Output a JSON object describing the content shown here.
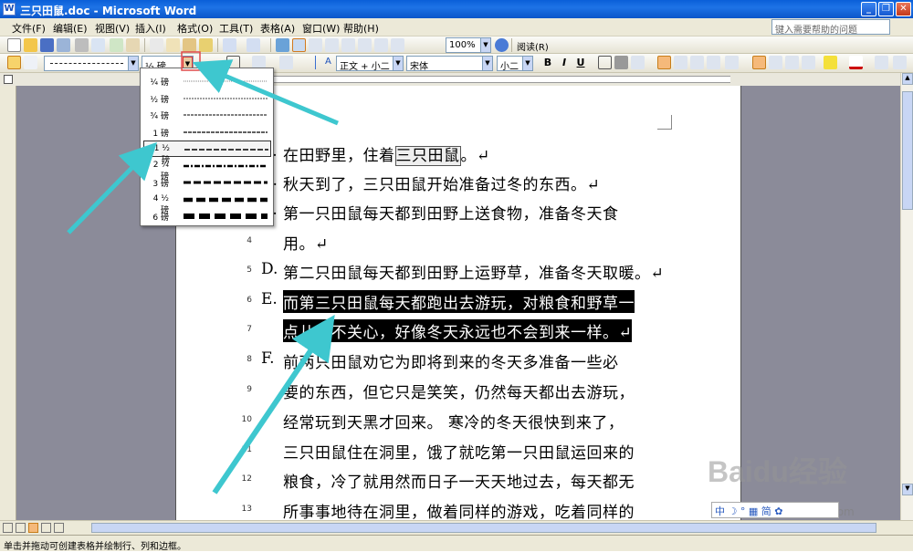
{
  "window": {
    "title": "三只田鼠.doc - Microsoft Word"
  },
  "menubar": {
    "items": [
      "文件(F)",
      "编辑(E)",
      "视图(V)",
      "插入(I)",
      "格式(O)",
      "工具(T)",
      "表格(A)",
      "窗口(W)",
      "帮助(H)"
    ],
    "help_placeholder": "键入需要帮助的问题"
  },
  "toolbar": {
    "zoom": "100%",
    "read_label": "阅读(R)"
  },
  "format_bar": {
    "line_weight": "½ 磅",
    "style": "正文 + 小二",
    "font": "宋体",
    "size": "小二",
    "bold": "B",
    "italic": "I",
    "underline": "U"
  },
  "line_weight_menu": {
    "items": [
      "¼ 磅",
      "½ 磅",
      "¾ 磅",
      "1 磅",
      "1 ½ 磅",
      "2 ¼ 磅",
      "3 磅",
      "4 ½ 磅",
      "6 磅"
    ],
    "selected_index": 4
  },
  "document": {
    "lines": [
      {
        "num": "",
        "mark": "A.",
        "text": "在田野里，住着三只田鼠。↵"
      },
      {
        "num": "",
        "mark": "B.",
        "text": "秋天到了，三只田鼠开始准备过冬的东西。↵"
      },
      {
        "num": "",
        "mark": "C.",
        "text": "第一只田鼠每天都到田野上送食物，准备冬天食"
      },
      {
        "num": "4",
        "mark": "",
        "text": "用。↵"
      },
      {
        "num": "5",
        "mark": "D.",
        "text": "第二只田鼠每天都到田野上运野草，准备冬天取暖。↵"
      },
      {
        "num": "6",
        "mark": "E.",
        "text": "而第三只田鼠每天都跑出去游玩，对粮食和野草一"
      },
      {
        "num": "7",
        "mark": "",
        "text": "点儿也不关心，好像冬天永远也不会到来一样。↵"
      },
      {
        "num": "8",
        "mark": "F.",
        "text": " 前两只田鼠劝它为即将到来的冬天多准备一些必"
      },
      {
        "num": "9",
        "mark": "",
        "text": "要的东西，但它只是笑笑，仍然每天都出去游玩，"
      },
      {
        "num": "10",
        "mark": "",
        "text": "经常玩到天黑才回来。 寒冷的冬天很快到来了，"
      },
      {
        "num": "11",
        "mark": "",
        "text": "三只田鼠住在洞里，饿了就吃第一只田鼠运回来的"
      },
      {
        "num": "12",
        "mark": "",
        "text": "粮食，冷了就用然而日子一天天地过去，每天都无"
      },
      {
        "num": "13",
        "mark": "",
        "text": "所事事地待在洞里，做着同样的游戏，吃着同样的"
      }
    ],
    "highlighted_word": "三只田鼠"
  },
  "statusbar": {
    "text": "单击并拖动可创建表格并绘制行、列和边框。"
  },
  "watermark": {
    "text": "Baidu经验",
    "sub": "jingyan.baidu.com",
    "ime": "中 ☽ ° ▦ 简 ✿"
  },
  "colors": {
    "title": "#0a5fd8",
    "arrow": "#3ec7cf",
    "highlight": "#000000",
    "menu_bg": "#ece9d8"
  }
}
